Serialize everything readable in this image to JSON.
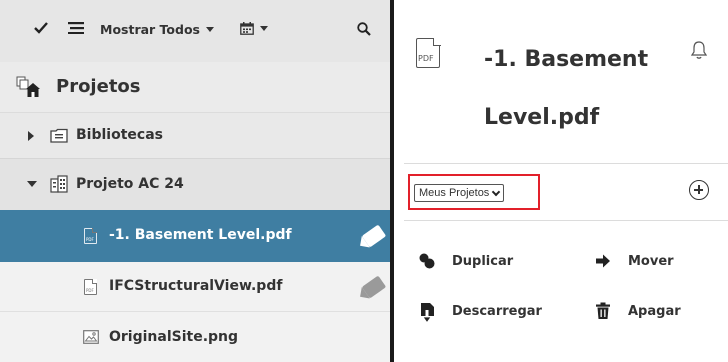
{
  "toolbar": {
    "check_icon": "check-icon",
    "list_icon": "list-icon",
    "filter_label": "Mostrar Todos",
    "calendar_icon": "calendar-icon",
    "search_icon": "search-icon"
  },
  "tree": {
    "root": {
      "label": "Projetos",
      "icon": "projects-icon"
    },
    "items": [
      {
        "label": "Bibliotecas",
        "icon": "library-icon",
        "expanded": false
      },
      {
        "label": "Projeto AC 24",
        "icon": "building-icon",
        "expanded": true
      },
      {
        "label": "-1. Basement Level.pdf",
        "icon": "pdf-file-icon",
        "selected": true,
        "tag": true
      },
      {
        "label": "IFCStructuralView.pdf",
        "icon": "pdf-file-icon",
        "selected": false,
        "tag": true
      },
      {
        "label": "OriginalSite.png",
        "icon": "image-file-icon",
        "selected": false,
        "tag": false
      }
    ]
  },
  "detail": {
    "title_line1": "-1. Basement",
    "title_line2": "Level.pdf",
    "file_icon_text": "PDF",
    "project_select": {
      "value": "Meus Projetos"
    },
    "actions": {
      "duplicate": "Duplicar",
      "move": "Mover",
      "download": "Descarregar",
      "delete": "Apagar"
    }
  },
  "colors": {
    "selected_row": "#3f7ea2",
    "highlight_border": "#e2202a",
    "divider": "#1a1a1a"
  }
}
